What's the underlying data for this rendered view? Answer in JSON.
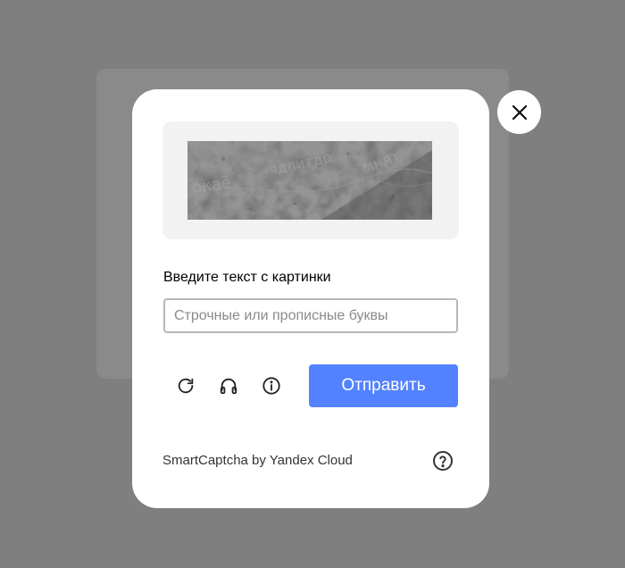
{
  "captcha": {
    "prompt": "Введите текст с картинки",
    "input_placeholder": "Строчные или прописные буквы",
    "input_value": "",
    "submit_label": "Отправить",
    "footer": "SmartCaptcha by Yandex Cloud"
  },
  "icons": {
    "close": "close-icon",
    "refresh": "refresh-icon",
    "audio": "headphones-icon",
    "info": "info-icon",
    "help": "help-icon"
  },
  "colors": {
    "accent": "#5282ff",
    "overlay": "#7f7f7f",
    "image_panel": "#f2f2f2",
    "input_border": "#b7b7b7"
  }
}
